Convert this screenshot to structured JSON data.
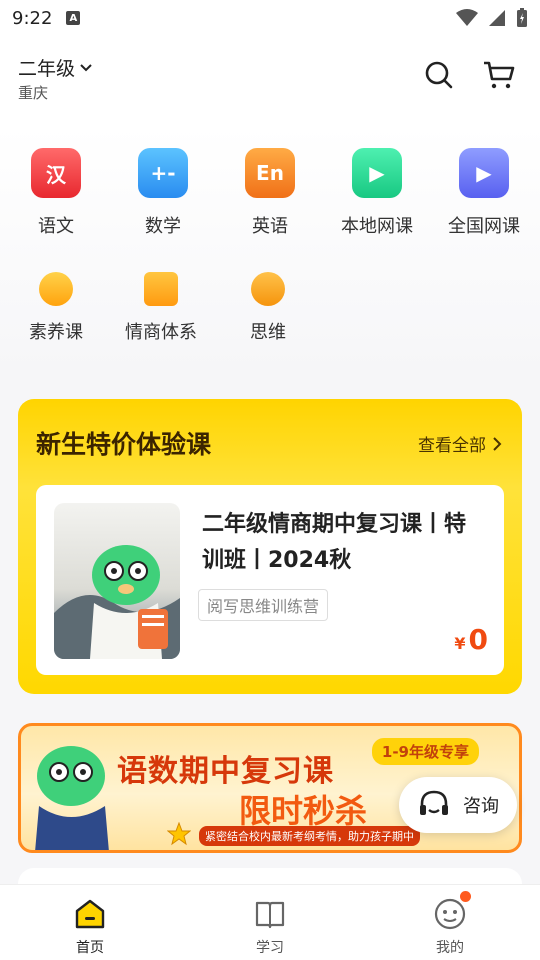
{
  "statusbar": {
    "time": "9:22"
  },
  "header": {
    "grade": "二年级",
    "city": "重庆"
  },
  "subjects": [
    {
      "label": "语文",
      "glyph": "汉",
      "icon": "chinese-icon"
    },
    {
      "label": "数学",
      "glyph": "+-",
      "icon": "math-icon"
    },
    {
      "label": "英语",
      "glyph": "En",
      "icon": "english-icon"
    },
    {
      "label": "本地网课",
      "glyph": "▶",
      "icon": "local-course-icon"
    },
    {
      "label": "全国网课",
      "glyph": "▶",
      "icon": "national-course-icon"
    },
    {
      "label": "素养课",
      "glyph": "",
      "icon": "heart-icon"
    },
    {
      "label": "情商体系",
      "glyph": "",
      "icon": "gift-box-icon"
    },
    {
      "label": "思维",
      "glyph": "",
      "icon": "planet-icon"
    }
  ],
  "promo": {
    "title": "新生特价体验课",
    "more": "查看全部",
    "course": {
      "title": "二年级情商期中复习课丨特训班丨2024秋",
      "tag": "阅写思维训练营",
      "currency": "¥",
      "price": "0"
    }
  },
  "banner": {
    "title1": "语数期中复习课",
    "title2": "限时秒杀",
    "chip": "1-9年级专享",
    "subtitle": "紧密结合校内最新考纲考情，助力孩子期中"
  },
  "consult": {
    "label": "咨询"
  },
  "tabbar": [
    {
      "label": "首页",
      "icon": "home-icon"
    },
    {
      "label": "学习",
      "icon": "book-icon"
    },
    {
      "label": "我的",
      "icon": "profile-icon"
    }
  ],
  "colors": {
    "accent": "#ffd400",
    "price": "#f04a10",
    "badge": "#ff5a1e"
  }
}
